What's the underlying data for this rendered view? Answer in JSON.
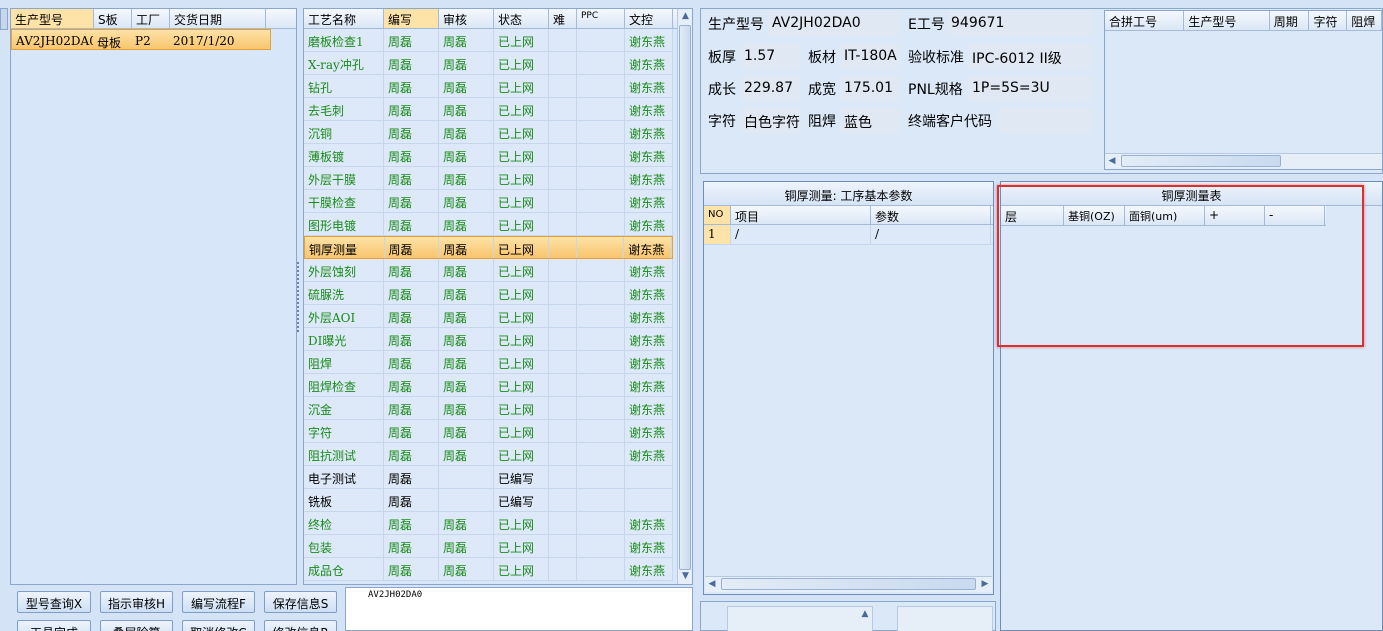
{
  "left_grid": {
    "headers": [
      "生产型号",
      "S板",
      "工厂",
      "交货日期"
    ],
    "rows": [
      [
        "AV2JH02DA0",
        "母板",
        "P2",
        "2017/1/20"
      ]
    ]
  },
  "process_grid": {
    "headers": [
      "工艺名称",
      "编写",
      "审核",
      "状态",
      "难",
      "PPC",
      "文控"
    ],
    "rows": [
      {
        "cells": [
          "磨板检查1",
          "周磊",
          "周磊",
          "已上网",
          "",
          "",
          "谢东燕"
        ],
        "green": true
      },
      {
        "cells": [
          "X-ray冲孔",
          "周磊",
          "周磊",
          "已上网",
          "",
          "",
          "谢东燕"
        ],
        "green": true
      },
      {
        "cells": [
          "钻孔",
          "周磊",
          "周磊",
          "已上网",
          "",
          "",
          "谢东燕"
        ],
        "green": true
      },
      {
        "cells": [
          "去毛刺",
          "周磊",
          "周磊",
          "已上网",
          "",
          "",
          "谢东燕"
        ],
        "green": true
      },
      {
        "cells": [
          "沉铜",
          "周磊",
          "周磊",
          "已上网",
          "",
          "",
          "谢东燕"
        ],
        "green": true
      },
      {
        "cells": [
          "薄板镀",
          "周磊",
          "周磊",
          "已上网",
          "",
          "",
          "谢东燕"
        ],
        "green": true
      },
      {
        "cells": [
          "外层干膜",
          "周磊",
          "周磊",
          "已上网",
          "",
          "",
          "谢东燕"
        ],
        "green": true
      },
      {
        "cells": [
          "干膜检查",
          "周磊",
          "周磊",
          "已上网",
          "",
          "",
          "谢东燕"
        ],
        "green": true
      },
      {
        "cells": [
          "图形电镀",
          "周磊",
          "周磊",
          "已上网",
          "",
          "",
          "谢东燕"
        ],
        "green": true
      },
      {
        "cells": [
          "铜厚测量",
          "周磊",
          "周磊",
          "已上网",
          "",
          "",
          "谢东燕"
        ],
        "green": false,
        "selected": true
      },
      {
        "cells": [
          "外层蚀刻",
          "周磊",
          "周磊",
          "已上网",
          "",
          "",
          "谢东燕"
        ],
        "green": true
      },
      {
        "cells": [
          "硫脲洗",
          "周磊",
          "周磊",
          "已上网",
          "",
          "",
          "谢东燕"
        ],
        "green": true
      },
      {
        "cells": [
          "外层AOI",
          "周磊",
          "周磊",
          "已上网",
          "",
          "",
          "谢东燕"
        ],
        "green": true
      },
      {
        "cells": [
          "DI曝光",
          "周磊",
          "周磊",
          "已上网",
          "",
          "",
          "谢东燕"
        ],
        "green": true
      },
      {
        "cells": [
          "阻焊",
          "周磊",
          "周磊",
          "已上网",
          "",
          "",
          "谢东燕"
        ],
        "green": true
      },
      {
        "cells": [
          "阻焊检查",
          "周磊",
          "周磊",
          "已上网",
          "",
          "",
          "谢东燕"
        ],
        "green": true
      },
      {
        "cells": [
          "沉金",
          "周磊",
          "周磊",
          "已上网",
          "",
          "",
          "谢东燕"
        ],
        "green": true
      },
      {
        "cells": [
          "字符",
          "周磊",
          "周磊",
          "已上网",
          "",
          "",
          "谢东燕"
        ],
        "green": true
      },
      {
        "cells": [
          "阻抗测试",
          "周磊",
          "周磊",
          "已上网",
          "",
          "",
          "谢东燕"
        ],
        "green": true
      },
      {
        "cells": [
          "电子测试",
          "周磊",
          "",
          "已编写",
          "",
          "",
          ""
        ],
        "green": false
      },
      {
        "cells": [
          "铣板",
          "周磊",
          "",
          "已编写",
          "",
          "",
          ""
        ],
        "green": false
      },
      {
        "cells": [
          "终检",
          "周磊",
          "周磊",
          "已上网",
          "",
          "",
          "谢东燕"
        ],
        "green": true
      },
      {
        "cells": [
          "包装",
          "周磊",
          "周磊",
          "已上网",
          "",
          "",
          "谢东燕"
        ],
        "green": true
      },
      {
        "cells": [
          "成品仓",
          "周磊",
          "周磊",
          "已上网",
          "",
          "",
          "谢东燕"
        ],
        "green": true
      }
    ]
  },
  "buttons": {
    "row1": [
      "型号查询X",
      "指示审核H",
      "编写流程F",
      "保存信息S"
    ],
    "row2": [
      "工具完成",
      "叠层除算",
      "取消修改C",
      "修改信息R"
    ]
  },
  "note_text": "AV2JH02DA0",
  "info": {
    "model_label": "生产型号",
    "model_value": "AV2JH02DA0",
    "e_label": "E工号",
    "e_value": "949671",
    "thickness_label": "板厚",
    "thickness_value": "1.57",
    "material_label": "板材",
    "material_value": "IT-180A",
    "standard_label": "验收标准",
    "standard_value": "IPC-6012 II级",
    "length_label": "成长",
    "length_value": "229.87",
    "width_label": "成宽",
    "width_value": "175.01",
    "pnl_label": "PNL规格",
    "pnl_value": "1P=5S=3U",
    "char_label": "字符",
    "char_value": "白色字符",
    "mask_label": "阻焊",
    "mask_value": "蓝色",
    "customer_label": "终端客户代码",
    "customer_value": ""
  },
  "merge_grid": {
    "headers": [
      "合拼工号",
      "生产型号",
      "周期",
      "字符",
      "阻焊"
    ]
  },
  "params_panel": {
    "title": "铜厚测量: 工序基本参数",
    "headers": [
      "NO",
      "项目",
      "参数"
    ],
    "rows": [
      [
        "1",
        "/",
        "/"
      ]
    ]
  },
  "thickness_panel": {
    "title": "铜厚测量表",
    "headers": [
      "层",
      "基铜(OZ)",
      "面铜(um)",
      "+",
      "-"
    ]
  }
}
